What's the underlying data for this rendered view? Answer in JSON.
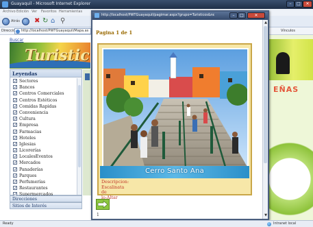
{
  "browser": {
    "title": "Guayaquil - Microsoft Internet Explorer",
    "menu": [
      "Archivo",
      "Edición",
      "Ver",
      "Favoritos",
      "Herramientas"
    ],
    "back_label": "Atrás",
    "address_label": "Dirección",
    "address": "http://localhost/PWTGuayaquil/Mapa.as",
    "links_label": "Vínculos"
  },
  "page": {
    "top_link": "Buscar",
    "banner_text": "Turistic",
    "legend_title": "Leyendas",
    "legend_items": [
      "Sectores",
      "Bancos",
      "Centros Comerciales",
      "Centros Estéticos",
      "Comidas Rapidas",
      "Conveniencia",
      "Cultura",
      "Empresa",
      "Farmacias",
      "Hoteles",
      "Iglesias",
      "Licorerías",
      "LocalesEventos",
      "Mercados",
      "Panaderías",
      "Parques",
      "Perfumerías",
      "Restaurantes",
      "Supermercados"
    ],
    "accordion": [
      "Direcciones",
      "Sitios de Interés"
    ],
    "right_text": "EÑAS"
  },
  "popup": {
    "title": "http://localhost/PWTGuayaquil/pagimar.aspx?grupo=Turisticos&nombre=...",
    "page_indicator": "Pagina 1 de 1",
    "caption": "Cerro Santo Ana",
    "description_lines": [
      "Descripcion:",
      "Escalinata",
      "de",
      "lo-Altar"
    ],
    "page_number": "1"
  },
  "status": {
    "ready": "Ready",
    "zone": "Intranet local"
  },
  "colors": {
    "caption_strip": "#2a8fc9",
    "card_background": "#f7e7a8",
    "next_button": "#8cc63f",
    "description_text": "#c0392b"
  }
}
